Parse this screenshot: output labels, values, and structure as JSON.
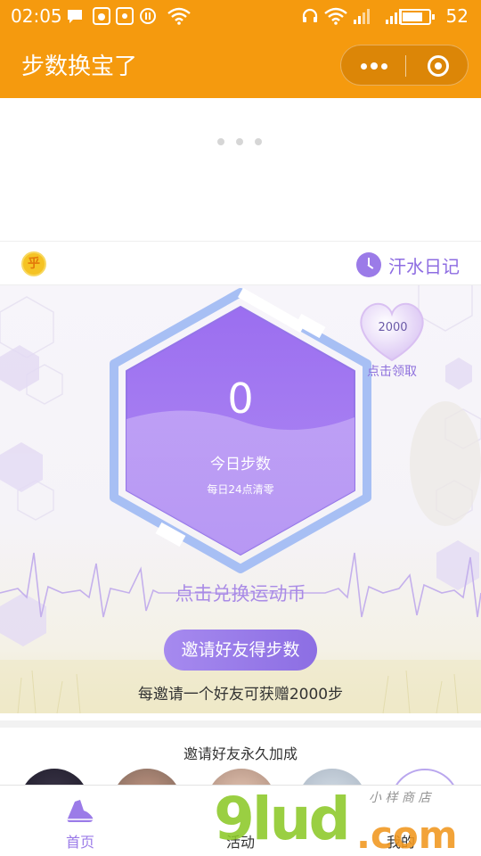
{
  "status_bar": {
    "time": "02:05",
    "battery": "52"
  },
  "title_bar": {
    "title": "步数换宝了"
  },
  "info_row": {
    "coin_symbol": "乎",
    "diary_label": "汗水日记"
  },
  "hero": {
    "step_count": "0",
    "step_label": "今日步数",
    "step_note": "每日24点清零",
    "bonus_value": "2000",
    "bonus_label": "点击领取",
    "exchange_label": "点击兑换运动币",
    "invite_button": "邀请好友得步数",
    "invite_note": "每邀请一个好友可获赠2000步"
  },
  "invite_section": {
    "title": "邀请好友永久加成"
  },
  "tabbar": {
    "tabs": [
      {
        "label": "首页"
      },
      {
        "label": "活动"
      },
      {
        "label": "我的"
      }
    ]
  },
  "watermark": {
    "text": "9lud",
    "suffix": ".com",
    "tag": "小 样 商 店"
  },
  "colors": {
    "accent": "#f59a0e",
    "brand_purple": "#9b7be8"
  },
  "icons": [
    "chat-icon",
    "uc-icon",
    "signal-app-icon",
    "pause-icon",
    "wifi-icon",
    "headset-icon",
    "cellular-icon",
    "battery-icon",
    "more-icon",
    "close-icon",
    "coin-icon",
    "clock-icon",
    "heart-icon",
    "shoe-icon"
  ]
}
